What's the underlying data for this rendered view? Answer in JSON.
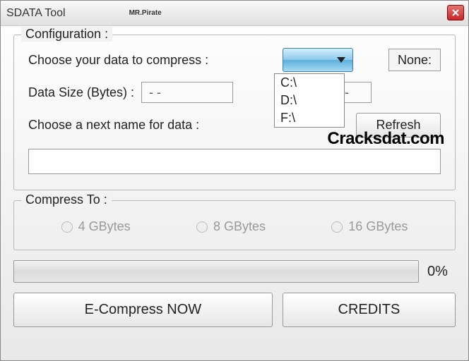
{
  "window": {
    "title": "SDATA Tool",
    "subtitle": "MR.Pirate"
  },
  "config": {
    "group_label": "Configuration :",
    "choose_label": "Choose your data to compress :",
    "none_label": "None:",
    "data_size_label": "Data Size (Bytes) :",
    "data_size_value": "- -",
    "data_size_right_fragment": ") :",
    "data_size_right_value": "- -",
    "next_name_label": "Choose a next name for data :",
    "refresh_label": "Refresh",
    "name_input_value": "",
    "drive_options": [
      "C:\\",
      "D:\\",
      "F:\\"
    ]
  },
  "watermark": "Cracksdat.com",
  "compress": {
    "group_label": "Compress To :",
    "options": [
      "4 GBytes",
      "8 GBytes",
      "16 GBytes"
    ]
  },
  "progress": {
    "percent_label": "0%"
  },
  "buttons": {
    "ecompress": "E-Compress NOW",
    "credits": "CREDITS"
  }
}
